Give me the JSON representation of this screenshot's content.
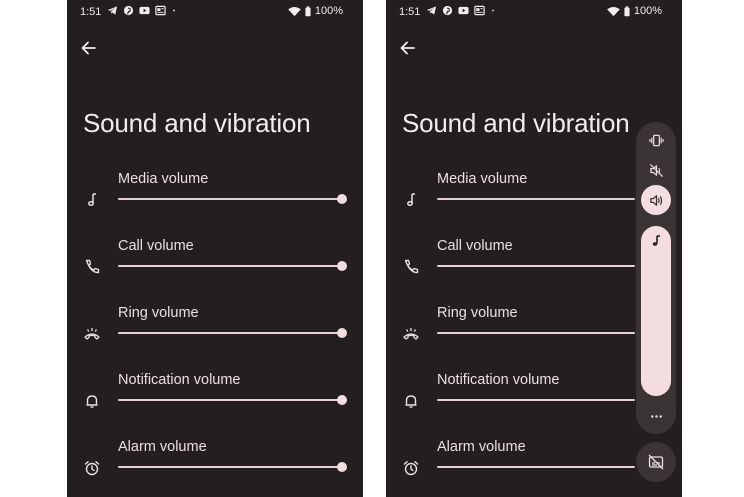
{
  "status_bar": {
    "time": "1:51",
    "battery": "100%"
  },
  "settings": {
    "title": "Sound and vibration",
    "rows": [
      {
        "label": "Media volume",
        "icon": "music-note-icon",
        "level": 1.0
      },
      {
        "label": "Call volume",
        "icon": "phone-icon",
        "level": 1.0
      },
      {
        "label": "Ring volume",
        "icon": "ringer-icon",
        "level": 1.0
      },
      {
        "label": "Notification volume",
        "icon": "bell-icon",
        "level": 1.0
      },
      {
        "label": "Alarm volume",
        "icon": "alarm-icon",
        "level": 1.0
      }
    ]
  },
  "volume_panel": {
    "buttons": [
      "vibrate-icon",
      "mute-icon",
      "sound-on-icon"
    ],
    "active_mode": "sound-on",
    "slider_icon": "music-note-icon",
    "slider_level": 1.0,
    "more_icon": "more-dots-icon",
    "caption_icon": "live-caption-off-icon"
  },
  "colors": {
    "background": "#231e1f",
    "accent": "#f4dde1",
    "panel": "#3a3435",
    "text": "#ebe0e1"
  }
}
